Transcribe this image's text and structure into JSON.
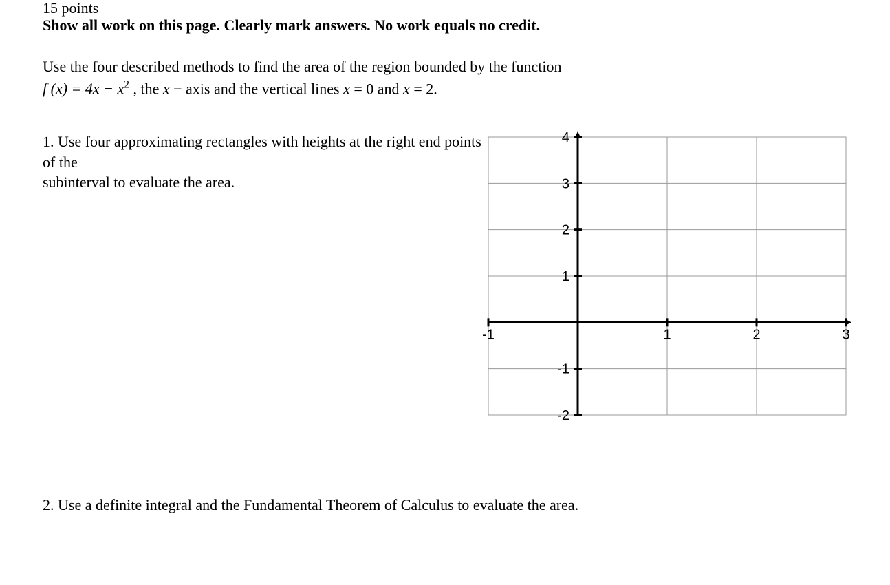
{
  "header": {
    "points": "15 points",
    "instruction": "Show all work on this page.  Clearly mark answers.  No work equals no credit."
  },
  "prompt": {
    "intro": "Use the four described methods to find the area of the region bounded by the function",
    "function_prefix": "f (x) = 4x − x",
    "function_exp": "2",
    "middle": " , the ",
    "xvar": "x",
    "dash": " − axis and the vertical lines ",
    "eq1_lhs": "x",
    "eq1_rhs": " = 0 and ",
    "eq2_lhs": "x",
    "eq2_rhs": " = 2."
  },
  "q1": {
    "num": "1.  ",
    "text_a": "Use four approximating rectangles with heights at the right end points of the",
    "text_b": "subinterval to evaluate the area."
  },
  "q2": {
    "num": "2.  ",
    "text": "Use a definite integral and the Fundamental Theorem of Calculus to evaluate the area."
  },
  "chart_data": {
    "type": "scatter",
    "title": "",
    "xlabel": "",
    "ylabel": "",
    "xlim": [
      -1,
      3
    ],
    "ylim": [
      -2,
      4
    ],
    "xticks": [
      -1,
      1,
      2,
      3
    ],
    "yticks": [
      -2,
      -1,
      1,
      2,
      3,
      4
    ],
    "grid": true,
    "series": []
  }
}
